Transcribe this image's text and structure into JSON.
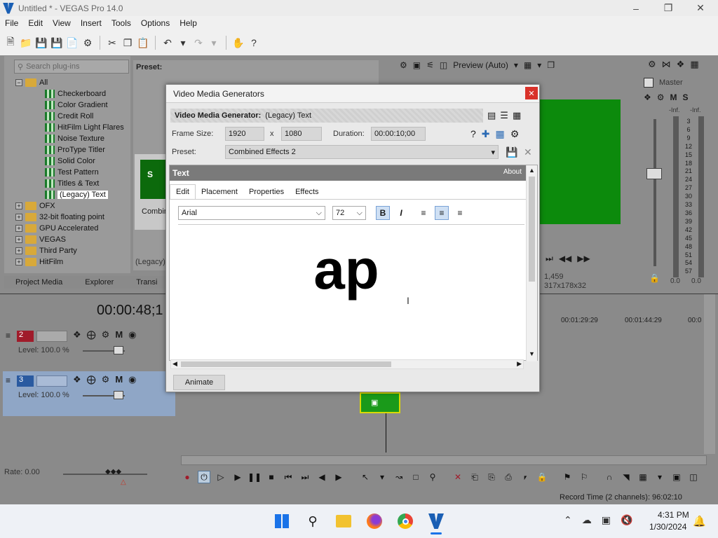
{
  "window": {
    "title": "Untitled * - VEGAS Pro 14.0"
  },
  "menu": [
    "File",
    "Edit",
    "View",
    "Insert",
    "Tools",
    "Options",
    "Help"
  ],
  "plugins": {
    "search_placeholder": "Search plug-ins",
    "preset_label": "Preset:",
    "tree": [
      {
        "label": "All",
        "kind": "folder",
        "expanded": true
      },
      {
        "label": "Checkerboard",
        "kind": "plugin"
      },
      {
        "label": "Color Gradient",
        "kind": "plugin"
      },
      {
        "label": "Credit Roll",
        "kind": "plugin"
      },
      {
        "label": "HitFilm Light Flares",
        "kind": "plugin"
      },
      {
        "label": "Noise Texture",
        "kind": "plugin"
      },
      {
        "label": "ProType Titler",
        "kind": "plugin"
      },
      {
        "label": "Solid Color",
        "kind": "plugin"
      },
      {
        "label": "Test Pattern",
        "kind": "plugin"
      },
      {
        "label": "Titles & Text",
        "kind": "plugin"
      },
      {
        "label": "(Legacy) Text",
        "kind": "plugin",
        "selected": true
      },
      {
        "label": "OFX",
        "kind": "folder"
      },
      {
        "label": "32-bit floating point",
        "kind": "folder"
      },
      {
        "label": "GPU Accelerated",
        "kind": "folder"
      },
      {
        "label": "VEGAS",
        "kind": "folder"
      },
      {
        "label": "Third Party",
        "kind": "folder"
      },
      {
        "label": "HitFilm",
        "kind": "folder"
      }
    ],
    "preset_thumb_label": "Combin",
    "preset_thumb_letter": "S",
    "legacy_label": "(Legacy)"
  },
  "bottom_tabs": [
    "Project Media",
    "Explorer",
    "Transi"
  ],
  "preview": {
    "mode_label": "Preview (Auto)",
    "frame_info_1": "1,459",
    "frame_info_2": "317x178x32"
  },
  "mixer": {
    "title": "Master",
    "m_label": "M",
    "s_label": "S",
    "inf_left": "-Inf.",
    "inf_right": "-Inf.",
    "scale": [
      "3",
      "6",
      "9",
      "12",
      "15",
      "18",
      "21",
      "24",
      "27",
      "30",
      "33",
      "36",
      "39",
      "42",
      "45",
      "48",
      "51",
      "54",
      "57"
    ],
    "bottom_left": "0.0",
    "bottom_right": "0.0"
  },
  "dialog": {
    "title": "Video Media Generators",
    "generator_label": "Video Media Generator:",
    "generator_value": "(Legacy) Text",
    "frame_size_label": "Frame Size:",
    "width": "1920",
    "x_label": "x",
    "height": "1080",
    "duration_label": "Duration:",
    "duration": "00:00:10;00",
    "preset_label": "Preset:",
    "preset_value": "Combined Effects 2",
    "inner_title": "Text",
    "about_label": "About",
    "tabs": [
      "Edit",
      "Placement",
      "Properties",
      "Effects"
    ],
    "font": "Arial",
    "font_size": "72",
    "bold_label": "B",
    "italic_label": "I",
    "text_content": "ap",
    "animate_label": "Animate"
  },
  "timeline": {
    "timecode": "00:00:48;1",
    "ruler_marks": [
      "00:01:29:29",
      "00:01:44:29",
      "00:0"
    ],
    "tracks": [
      {
        "number": "2",
        "level": "Level: 100.0 %",
        "m_label": "M"
      },
      {
        "number": "3",
        "level": "Level: 100.0 %",
        "m_label": "M"
      }
    ],
    "rate": "Rate: 0.00"
  },
  "status": {
    "record_time": "Record Time (2 channels): 96:02:10"
  },
  "taskbar": {
    "time": "4:31 PM",
    "date": "1/30/2024"
  },
  "colors": {
    "accent_green": "#0c8a0c",
    "track_red": "#a01b2a",
    "track_blue": "#2a5aa0",
    "close_red": "#d9322a"
  }
}
